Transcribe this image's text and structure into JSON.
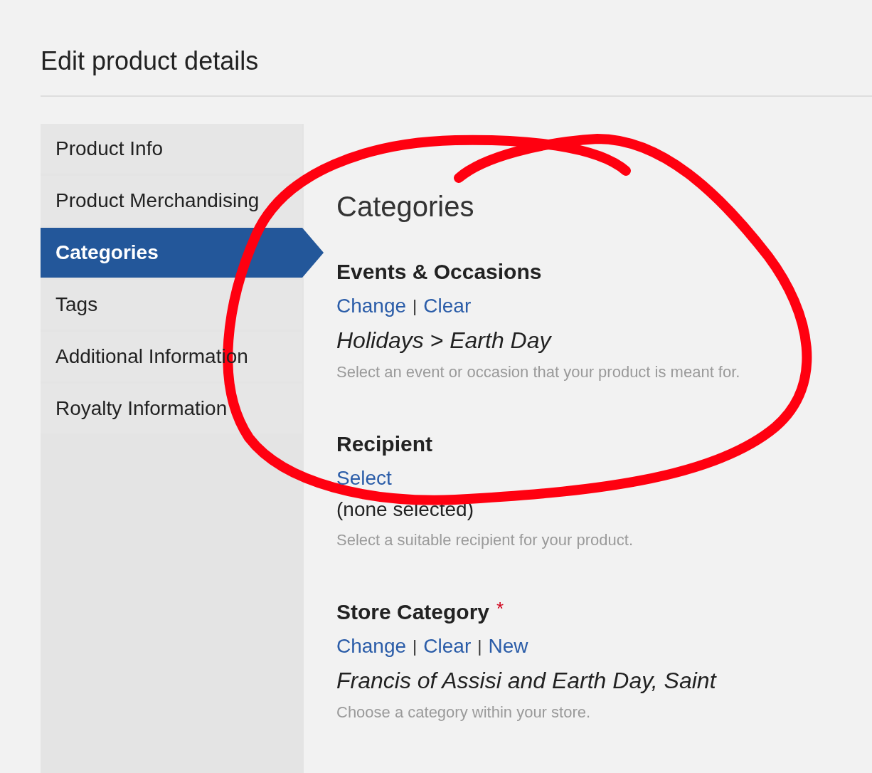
{
  "page_title": "Edit product details",
  "sidebar": {
    "items": [
      {
        "label": "Product Info",
        "selected": false
      },
      {
        "label": "Product Merchandising",
        "selected": false
      },
      {
        "label": "Categories",
        "selected": true
      },
      {
        "label": "Tags",
        "selected": false
      },
      {
        "label": "Additional Information",
        "selected": false
      },
      {
        "label": "Royalty Information",
        "selected": false
      }
    ]
  },
  "content": {
    "heading": "Categories",
    "sections": [
      {
        "title": "Events & Occasions",
        "links": [
          "Change",
          "Clear"
        ],
        "separators": [
          "|"
        ],
        "value": "Holidays > Earth Day",
        "italic": true,
        "hint": "Select an event or occasion that your product is meant for."
      },
      {
        "title": "Recipient",
        "links": [
          "Select"
        ],
        "value": "(none selected)",
        "italic": false,
        "hint": "Select a suitable recipient for your product."
      },
      {
        "title": "Store Category",
        "required_mark": "*",
        "links": [
          "Change",
          "Clear",
          "New"
        ],
        "separators": [
          "|",
          "|"
        ],
        "value": "Francis of Assisi and Earth Day, Saint",
        "italic": true,
        "hint": "Choose a category within your store."
      }
    ]
  },
  "annotation": {
    "kind": "circle"
  }
}
